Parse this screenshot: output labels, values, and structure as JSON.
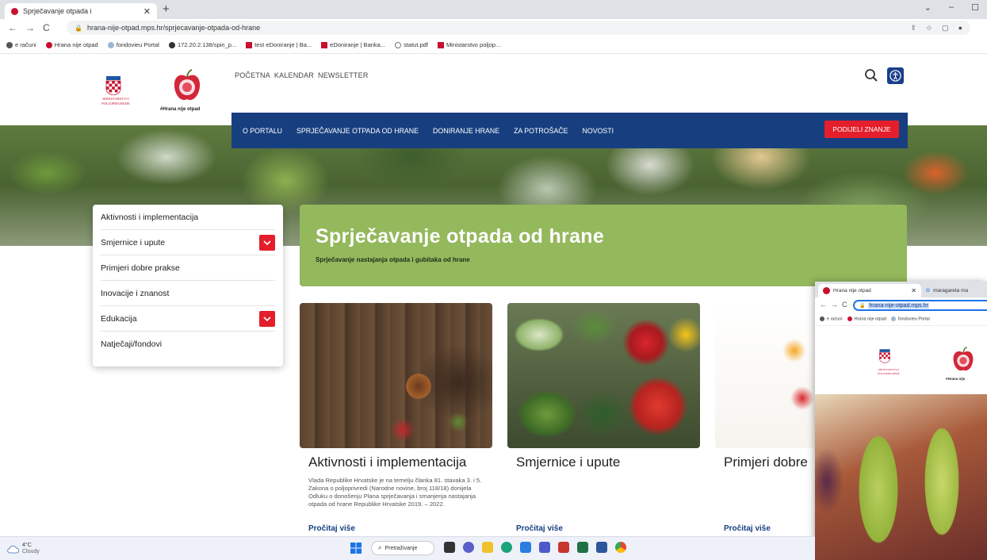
{
  "browser": {
    "tab_title": "Sprječavanje otpada i",
    "url": "hrana-nije-otpad.mps.hr/sprjecavanje-otpada-od-hrane",
    "bookmarks": [
      "e računi",
      "Hrana nije otpad",
      "fondovieu Portal",
      "172.20.2.138/spin_p...",
      "test eDoniranje | Ba...",
      "eDoniranje | Banka...",
      "statut.pdf",
      "Ministarstvo poljop..."
    ]
  },
  "header": {
    "ministry_line1": "MINISTARSTVO",
    "ministry_line2": "POLJOPRIVREDE",
    "brand": "#Hrana nije otpad",
    "top_nav": [
      "POČETNA",
      "KALENDAR",
      "NEWSLETTER"
    ],
    "main_nav": [
      "O PORTALU",
      "SPRJEČAVANJE OTPADA OD HRANE",
      "DONIRANJE HRANE",
      "ZA POTROŠAČE",
      "NOVOSTI"
    ],
    "share_button": "PODIJELI ZNANJE"
  },
  "sidebar": {
    "items": [
      {
        "label": "Aktivnosti i implementacija",
        "expandable": false
      },
      {
        "label": "Smjernice i upute",
        "expandable": true
      },
      {
        "label": "Primjeri dobre prakse",
        "expandable": false
      },
      {
        "label": "Inovacije i znanost",
        "expandable": false
      },
      {
        "label": "Edukacija",
        "expandable": true
      },
      {
        "label": "Natječaji/fondovi",
        "expandable": false
      }
    ]
  },
  "banner": {
    "title": "Sprječavanje otpada od hrane",
    "subtitle": "Sprječavanje nastajanja otpada i gubitaka od hrane"
  },
  "cards": [
    {
      "title": "Aktivnosti i implementacija",
      "text": "Vlada Republike Hrvatske je na temelju članka 81. stavaka 3. i 5. Zakona o poljoprivredi (Narodne novine, broj 118/18) donijela Odluku o donošenju Plana sprječavanja i smanjenja nastajanja otpada od hrane Republike Hrvatske 2019. – 2022.",
      "link": "Pročitaj više"
    },
    {
      "title": "Smjernice i upute",
      "text": "",
      "link": "Pročitaj više"
    },
    {
      "title": "Primjeri dobre",
      "text": "",
      "link": "Pročitaj više"
    }
  ],
  "overlay_window": {
    "tab1_title": "Hrana nije otpad",
    "tab2_title": "maragareta ma",
    "url": "hrana-nije-otpad.mps.hr",
    "bookmarks": [
      "e računi",
      "Hrana nije otpad",
      "fondovieu Portal"
    ],
    "ministry_line1": "MINISTARSTVO",
    "ministry_line2": "POLJOPRIVREDE",
    "brand": "#Hrana nije"
  },
  "taskbar": {
    "temperature": "4°C",
    "weather": "Cloudy",
    "search_label": "Pretraživanje"
  },
  "colors": {
    "nav_blue": "#173f7f",
    "accent_red": "#e41f2b",
    "banner_green": "#94b85c"
  }
}
